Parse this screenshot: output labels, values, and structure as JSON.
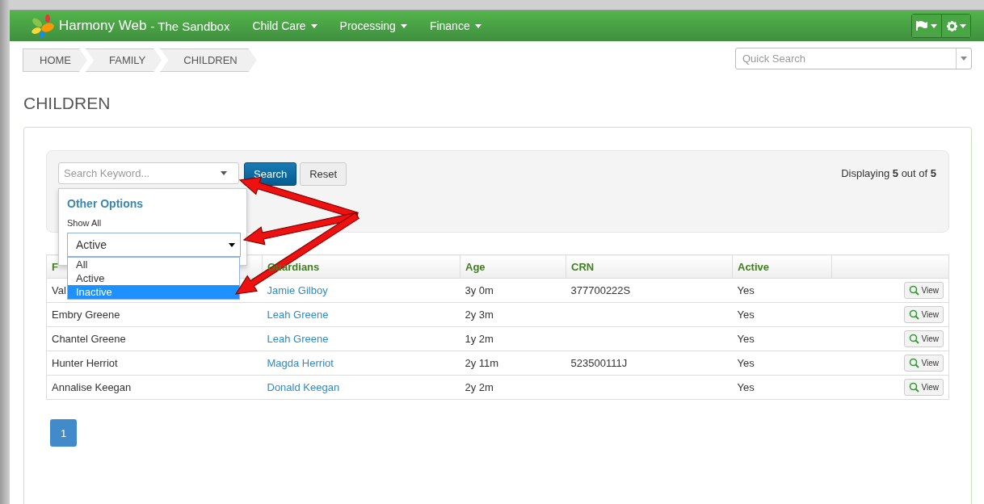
{
  "navbar": {
    "brand": "Harmony Web",
    "subtitle": "- The Sandbox",
    "menus": [
      {
        "label": "Child Care"
      },
      {
        "label": "Processing"
      },
      {
        "label": "Finance"
      }
    ]
  },
  "breadcrumb": [
    "HOME",
    "FAMILY",
    "CHILDREN"
  ],
  "quick_search": {
    "placeholder": "Quick Search"
  },
  "page_title": "CHILDREN",
  "search": {
    "placeholder": "Search Keyword...",
    "buttons": [
      "Search",
      "Reset"
    ],
    "summary": "Displaying **5** out of **5**"
  },
  "options_popup": {
    "title": "Other Options",
    "label": "Show All",
    "value": "Active",
    "options": [
      {
        "label": "All",
        "highlighted": false
      },
      {
        "label": "Active",
        "highlighted": false
      },
      {
        "label": "Inactive",
        "highlighted": true
      }
    ]
  },
  "table": {
    "columns": [
      "F",
      "Guardians",
      "Age",
      "CRN",
      "Active"
    ],
    "rows": [
      {
        "name": "Val",
        "guardian": "Jamie Gilboy",
        "age": "3y 0m",
        "crn": "377700222S",
        "active": "Yes",
        "action": "View"
      },
      {
        "name": "Embry Greene",
        "guardian": "Leah Greene",
        "age": "2y 3m",
        "crn": "",
        "active": "Yes",
        "action": "View"
      },
      {
        "name": "Chantel Greene",
        "guardian": "Leah Greene",
        "age": "1y 2m",
        "crn": "",
        "active": "Yes",
        "action": "View"
      },
      {
        "name": "Hunter Herriot",
        "guardian": "Magda Herriot",
        "age": "2y 11m",
        "crn": "523500111J",
        "active": "Yes",
        "action": "View"
      },
      {
        "name": "Annalise Keegan",
        "guardian": "Donald Keegan",
        "age": "2y 2m",
        "crn": "",
        "active": "Yes",
        "action": "View"
      }
    ]
  },
  "pagination": [
    {
      "label": "1",
      "selected": true
    }
  ]
}
